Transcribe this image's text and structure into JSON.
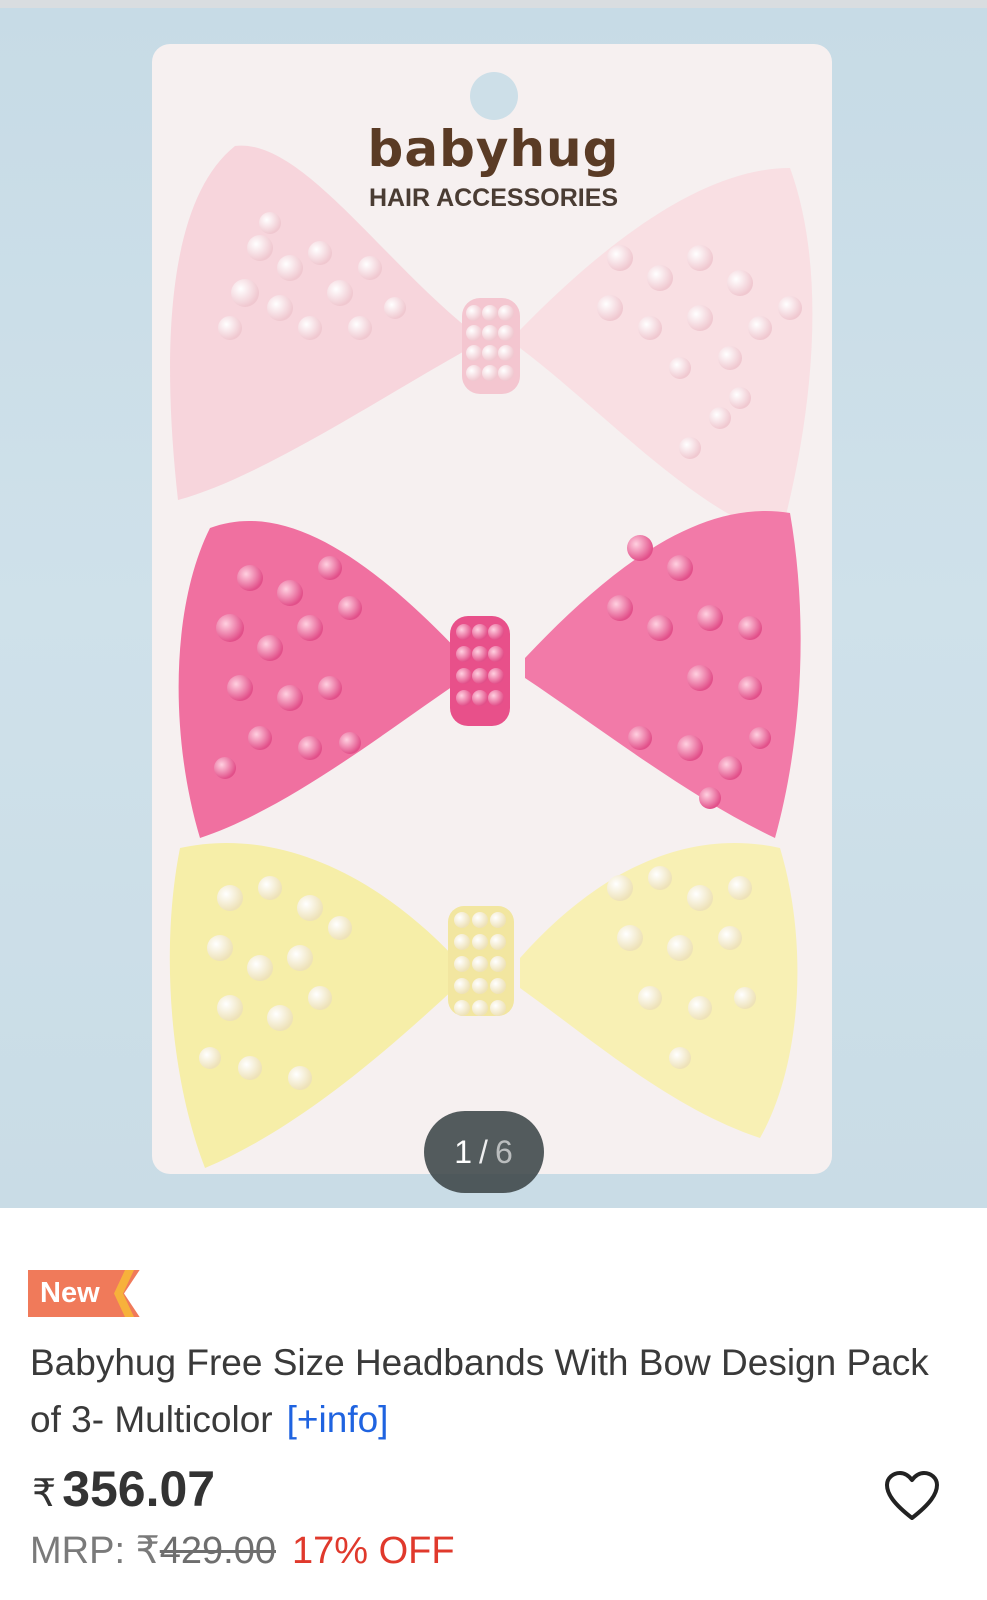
{
  "gallery": {
    "brand_logo_text": "babyhug",
    "brand_subtitle": "HAIR ACCESSORIES",
    "image_counter": {
      "current": "1",
      "separator": "/",
      "total": "6"
    },
    "bow_colors": [
      "#f7d3da",
      "#f06c9c",
      "#f6eea8"
    ]
  },
  "product": {
    "badge": "New",
    "title": "Babyhug Free Size Headbands With Bow Design Pack of 3- Multicolor",
    "info_link": "[+info]",
    "currency": "₹",
    "price": "356.07",
    "mrp_label": "MRP:",
    "mrp_value": "429.00",
    "discount": "17% OFF"
  },
  "icons": {
    "wishlist": "heart-outline-icon"
  },
  "colors": {
    "link": "#1f63e0",
    "discount": "#e0392c",
    "badge": "#f07a5a"
  }
}
